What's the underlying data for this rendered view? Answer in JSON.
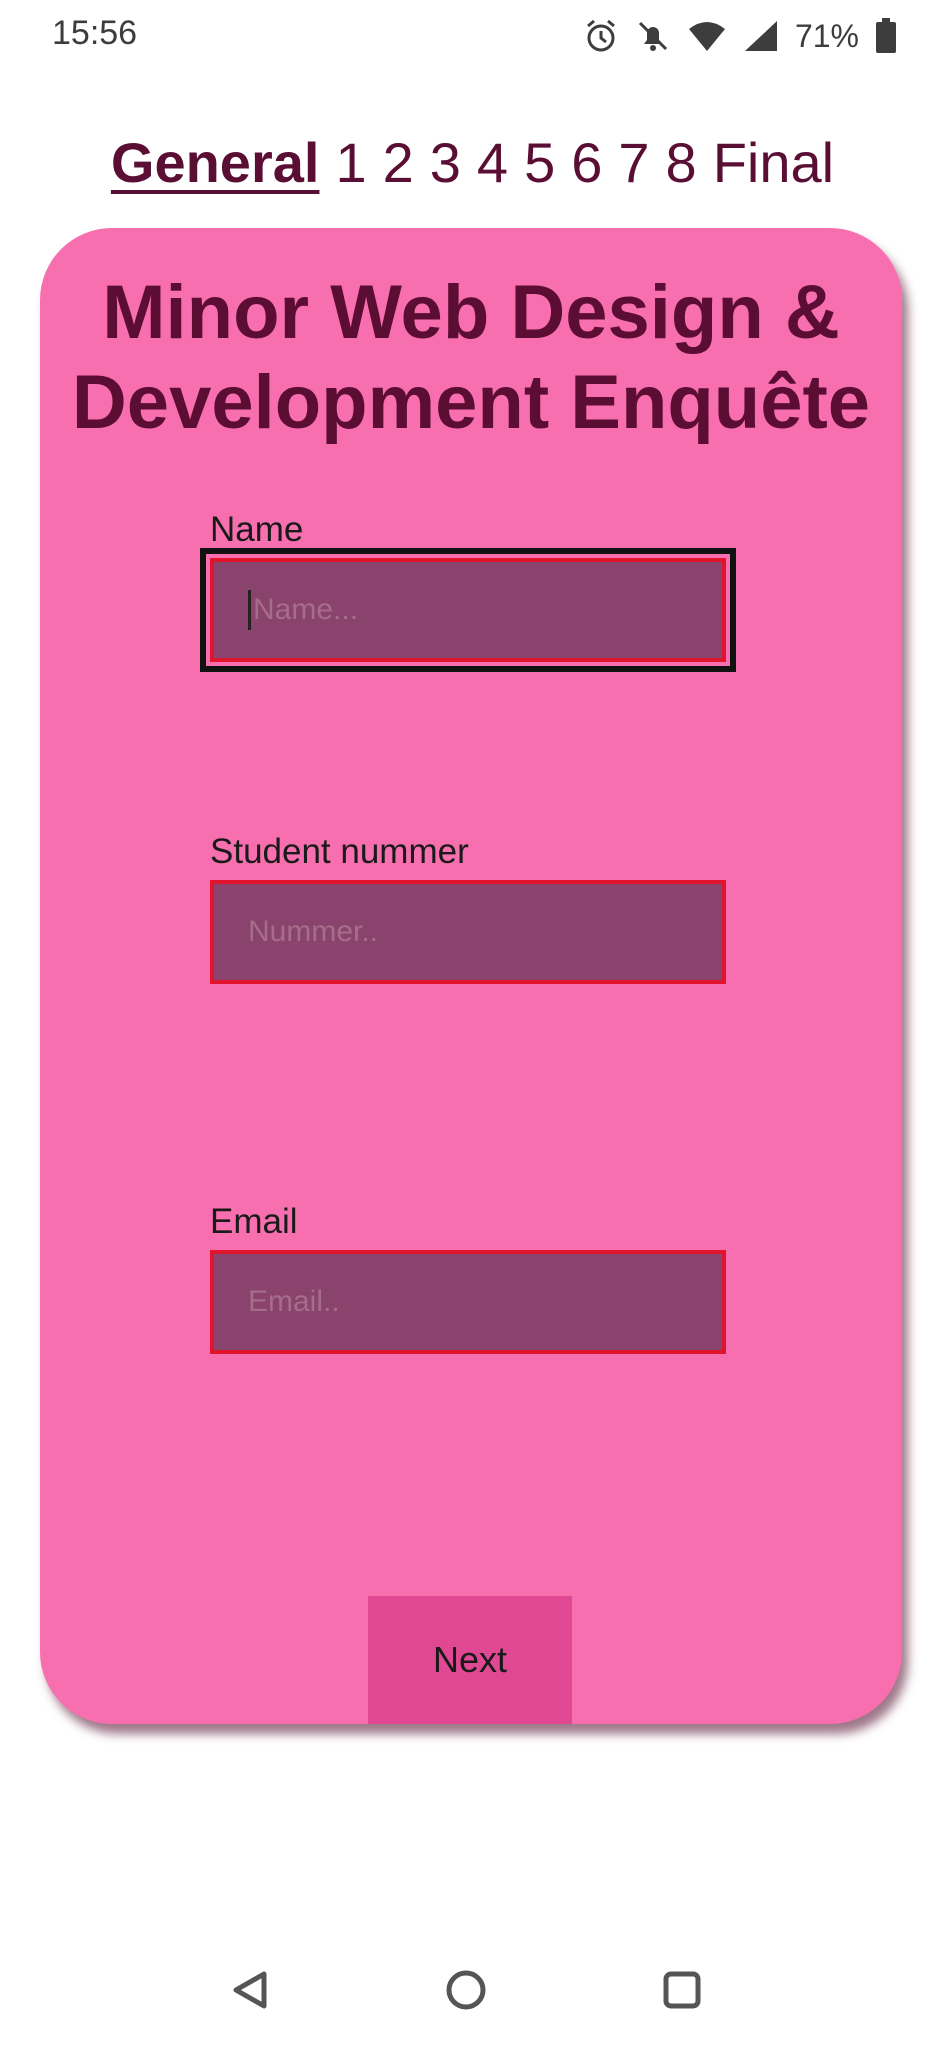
{
  "status": {
    "time": "15:56",
    "battery": "71%"
  },
  "steps": [
    "General",
    "1",
    "2",
    "3",
    "4",
    "5",
    "6",
    "7",
    "8",
    "Final"
  ],
  "title_line1": "Minor Web Design &",
  "title_line2": "Development Enquête",
  "fields": {
    "name": {
      "label": "Name",
      "placeholder": "Name..."
    },
    "student": {
      "label": "Student nummer",
      "placeholder": "Nummer.."
    },
    "email": {
      "label": "Email",
      "placeholder": "Email.."
    }
  },
  "next_label": "Next",
  "colors": {
    "card": "#f76fae",
    "title": "#5c0d33",
    "field_bg": "#89436c",
    "field_border": "#e0142c",
    "button": "#e04894"
  }
}
